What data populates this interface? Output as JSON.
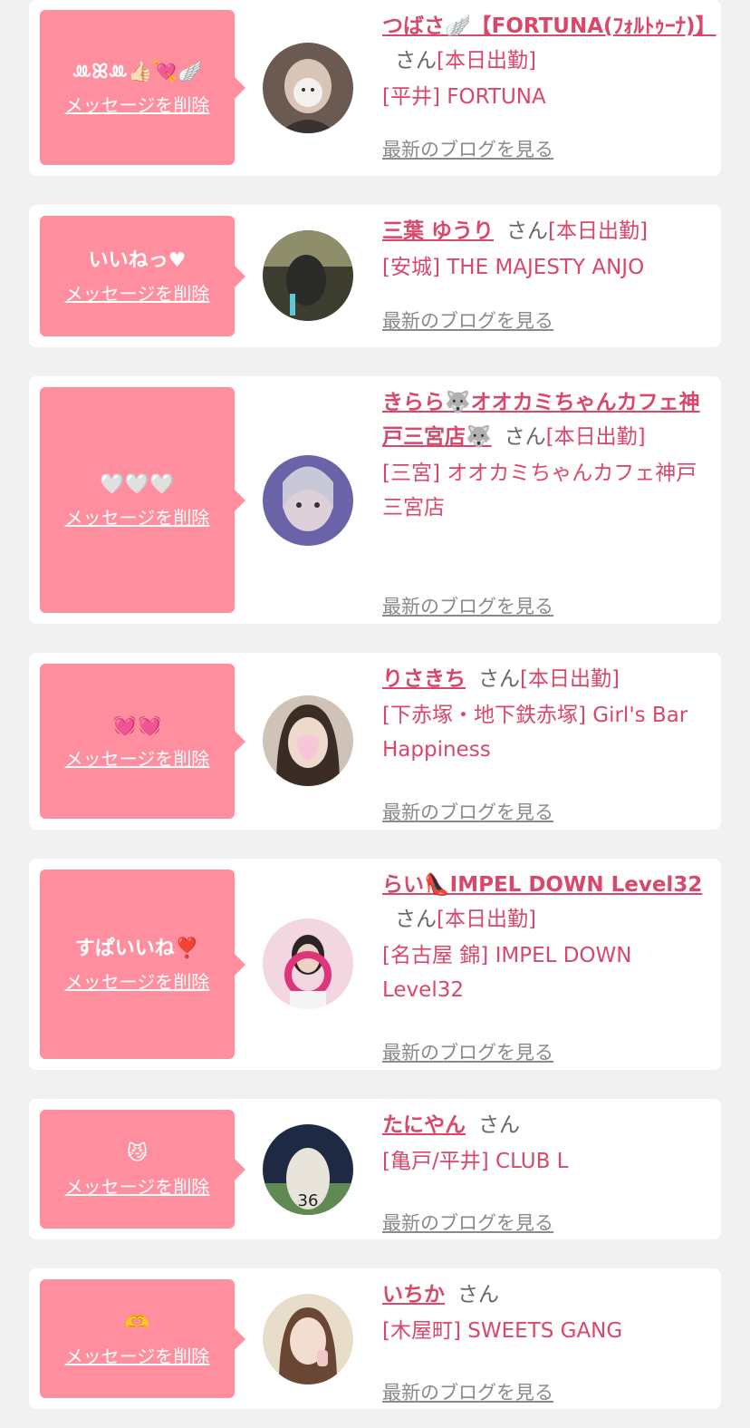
{
  "items": [
    {
      "message": "ꔛꕤꔛ👍🏻💘🪽",
      "delete_label": "メッセージを削除",
      "name": "つばさ🪽【FORTUNA(ﾌｫﾙﾄｩｰﾅ)】",
      "san": "さん",
      "status": "[本日出勤]",
      "shop": "[平井] FORTUNA",
      "blog_label": "最新のブログを見る"
    },
    {
      "message": "いいねっ♥",
      "delete_label": "メッセージを削除",
      "name": "三葉 ゆうり",
      "san": "さん",
      "status": "[本日出勤]",
      "shop": "[安城] THE MAJESTY ANJO",
      "blog_label": "最新のブログを見る"
    },
    {
      "message": "🤍🤍🤍",
      "delete_label": "メッセージを削除",
      "name": "きらら🐺オオカミちゃんカフェ神戸三宮店🐺",
      "san": "さん",
      "status": "[本日出勤]",
      "shop": "[三宮] オオカミちゃんカフェ神戸三宮店",
      "blog_label": "最新のブログを見る"
    },
    {
      "message": "💓💓",
      "delete_label": "メッセージを削除",
      "name": "りさきち",
      "san": "さん",
      "status": "[本日出勤]",
      "shop": "[下赤塚・地下鉄赤塚] Girl's Bar Happiness",
      "blog_label": "最新のブログを見る"
    },
    {
      "message": "すぱいいね❣️",
      "delete_label": "メッセージを削除",
      "name": "らい👠IMPEL DOWN Level32",
      "san": "さん",
      "status": "[本日出勤]",
      "shop": "[名古屋 錦] IMPEL DOWN Level32",
      "blog_label": "最新のブログを見る"
    },
    {
      "message": "😼",
      "delete_label": "メッセージを削除",
      "name": "たにやん",
      "san": "さん",
      "status": "",
      "shop": "[亀戸/平井] CLUB L",
      "blog_label": "最新のブログを見る"
    },
    {
      "message": "🫶",
      "delete_label": "メッセージを削除",
      "name": "いちか",
      "san": "さん",
      "status": "",
      "shop": "[木屋町] SWEETS GANG",
      "blog_label": "最新のブログを見る"
    }
  ],
  "colors": {
    "bubble": "#ff8f9e",
    "accent": "#d9476a",
    "muted": "#8a8a8a",
    "background": "#f1f1f1"
  },
  "icons": [
    "avatar-photo"
  ]
}
